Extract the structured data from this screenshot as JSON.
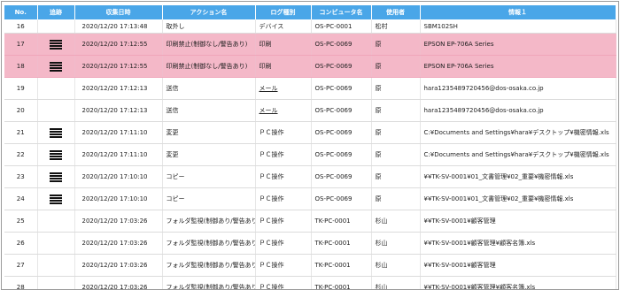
{
  "table": {
    "headers": [
      "No.",
      "追跡",
      "収集日時",
      "アクション名",
      "ログ種別",
      "コンピュータ名",
      "使用者",
      "情報１"
    ],
    "rows": [
      {
        "no": "16",
        "trace": false,
        "date": "2020/12/20 17:13:48",
        "action": "取外し",
        "logtype": "デバイス",
        "computer": "OS-PC-0001",
        "user": "松村",
        "info": "SBM102SH",
        "highlight": false
      },
      {
        "no": "17",
        "trace": true,
        "date": "2020/12/20 17:12:55",
        "action": "印刷禁止(制御なし/警告あり)",
        "logtype": "印刷",
        "computer": "OS-PC-0069",
        "user": "原",
        "info": "EPSON EP-706A Series",
        "highlight": true
      },
      {
        "no": "18",
        "trace": true,
        "date": "2020/12/20 17:12:55",
        "action": "印刷禁止(制御なし/警告あり)",
        "logtype": "印刷",
        "computer": "OS-PC-0069",
        "user": "原",
        "info": "EPSON EP-706A Series",
        "highlight": true
      },
      {
        "no": "19",
        "trace": false,
        "date": "2020/12/20 17:12:13",
        "action": "送信",
        "logtype": "メール",
        "computer": "OS-PC-0069",
        "user": "原",
        "info": "hara1235489720456@dos-osaka.co.jp",
        "highlight": false
      },
      {
        "no": "20",
        "trace": false,
        "date": "2020/12/20 17:12:13",
        "action": "送信",
        "logtype": "メール",
        "computer": "OS-PC-0069",
        "user": "原",
        "info": "hara1235489720456@dos-osaka.co.jp",
        "highlight": false
      },
      {
        "no": "21",
        "trace": true,
        "date": "2020/12/20 17:11:10",
        "action": "変更",
        "logtype": "ＰＣ操作",
        "computer": "OS-PC-0069",
        "user": "原",
        "info": "C:¥Documents and Settings¥hara¥デスクトップ¥機密情報.xls",
        "highlight": false
      },
      {
        "no": "22",
        "trace": true,
        "date": "2020/12/20 17:11:10",
        "action": "変更",
        "logtype": "ＰＣ操作",
        "computer": "OS-PC-0069",
        "user": "原",
        "info": "C:¥Documents and Settings¥hara¥デスクトップ¥機密情報.xls",
        "highlight": false
      },
      {
        "no": "23",
        "trace": true,
        "date": "2020/12/20 17:10:10",
        "action": "コピー",
        "logtype": "ＰＣ操作",
        "computer": "OS-PC-0069",
        "user": "原",
        "info": "¥¥TK-SV-0001¥01_文書管理¥02_重要¥機密情報.xls",
        "highlight": false
      },
      {
        "no": "24",
        "trace": true,
        "date": "2020/12/20 17:10:10",
        "action": "コピー",
        "logtype": "ＰＣ操作",
        "computer": "OS-PC-0069",
        "user": "原",
        "info": "¥¥TK-SV-0001¥01_文書管理¥02_重要¥機密情報.xls",
        "highlight": false
      },
      {
        "no": "25",
        "trace": false,
        "date": "2020/12/20 17:03:26",
        "action": "フォルダ監視(制御あり/警告あり)",
        "logtype": "ＰＣ操作",
        "computer": "TK-PC-0001",
        "user": "杉山",
        "info": "¥¥TK-SV-0001¥顧客管理",
        "highlight": false
      },
      {
        "no": "26",
        "trace": false,
        "date": "2020/12/20 17:03:26",
        "action": "フォルダ監視(制御あり/警告あり)",
        "logtype": "ＰＣ操作",
        "computer": "TK-PC-0001",
        "user": "杉山",
        "info": "¥¥TK-SV-0001¥顧客管理¥顧客名簿.xls",
        "highlight": false
      },
      {
        "no": "27",
        "trace": false,
        "date": "2020/12/20 17:03:26",
        "action": "フォルダ監視(制御あり/警告あり)",
        "logtype": "ＰＣ操作",
        "computer": "TK-PC-0001",
        "user": "杉山",
        "info": "¥¥TK-SV-0001¥顧客管理",
        "highlight": false
      },
      {
        "no": "28",
        "trace": false,
        "date": "2020/12/20 17:03:26",
        "action": "フォルダ監視(制御あり/警告あり)",
        "logtype": "ＰＣ操作",
        "computer": "TK-PC-0001",
        "user": "杉山",
        "info": "¥¥TK-SV-0001¥顧客管理¥顧客名簿.xls",
        "highlight": false
      }
    ]
  },
  "colors": {
    "header": "#4aa6e8",
    "highlight": "#f4b8c8"
  },
  "icons": {
    "trace": "list-icon"
  }
}
